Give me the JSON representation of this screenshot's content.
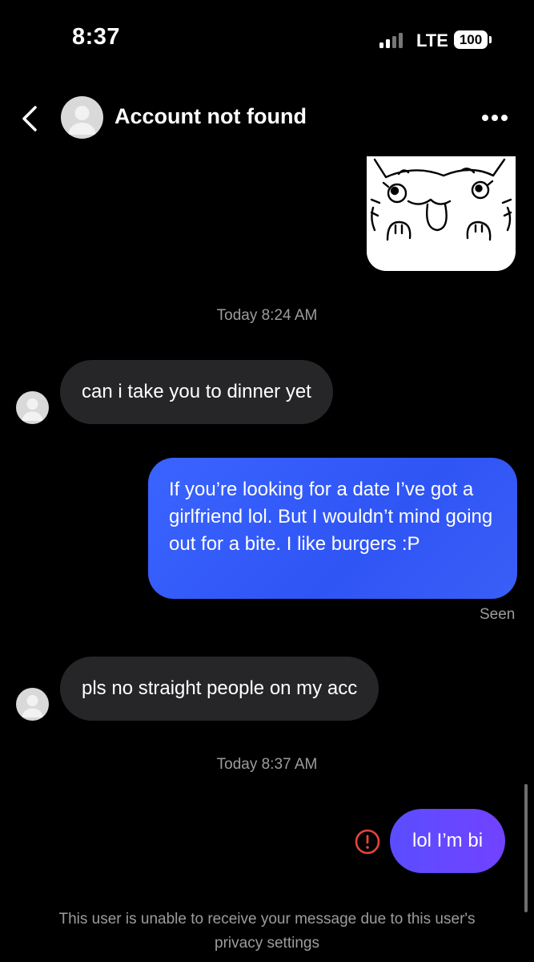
{
  "status_bar": {
    "time": "8:37",
    "network": "LTE",
    "battery": "100"
  },
  "header": {
    "title": "Account not found",
    "back_icon": "chevron-left-icon",
    "more_icon": "ellipsis-icon"
  },
  "messages": [
    {
      "type": "sticker",
      "direction": "outgoing",
      "description": "cat-sticker"
    },
    {
      "type": "timestamp",
      "text": "Today 8:24 AM"
    },
    {
      "type": "text",
      "direction": "incoming",
      "text": "can i take you to dinner yet"
    },
    {
      "type": "text",
      "direction": "outgoing",
      "text": "If you’re looking for a date I’ve got a girlfriend lol. But I wouldn’t mind going out for a bite. I like burgers :P",
      "status": "Seen"
    },
    {
      "type": "text",
      "direction": "incoming",
      "text": "pls no straight people on my acc"
    },
    {
      "type": "timestamp",
      "text": "Today 8:37 AM"
    },
    {
      "type": "text",
      "direction": "outgoing",
      "text": "lol I’m bi",
      "error": true
    }
  ],
  "footer": {
    "privacy_note": "This user is unable to receive your message due to this user's privacy settings"
  },
  "colors": {
    "background": "#000000",
    "incoming_bubble": "#262628",
    "outgoing_bubble": "#2f55f5",
    "outgoing_bubble_latest": "#6a45ff",
    "error": "#e5453a",
    "muted_text": "#9c9c9c"
  }
}
